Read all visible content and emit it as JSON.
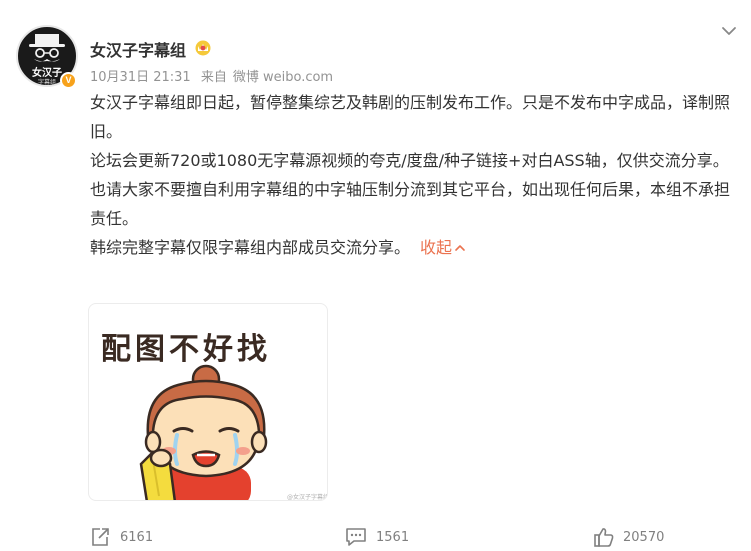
{
  "post": {
    "author": "女汉子字幕组",
    "avatar_text": "女汉子",
    "avatar_subtext": "字幕组",
    "verified_mark": "V",
    "timestamp": "10月31日 21:31",
    "source_prefix": "来自",
    "source": "微博 weibo.com",
    "paragraphs": [
      "女汉子字幕组即日起，暂停整集综艺及韩剧的压制发布工作。只是不发布中字成品，译制照旧。",
      "论坛会更新720或1080无字幕源视频的夸克/度盘/种子链接+对白ASS轴，仅供交流分享。",
      "也请大家不要擅自利用字幕组的中字轴压制分流到其它平台，如出现任何后果，本组不承担责任。",
      "韩综完整字幕仅限字幕组内部成员交流分享。"
    ],
    "collapse_label": "收起",
    "image": {
      "caption": "配图不好找",
      "watermark": "@女汉子字幕组"
    }
  },
  "actions": {
    "repost_count": "6161",
    "comment_count": "1561",
    "like_count": "20570"
  },
  "colors": {
    "accent": "#eb7350",
    "verified": "#f7a21b",
    "muted": "#939393"
  },
  "icons": [
    "chevron-down-icon",
    "crown-badge-icon",
    "repost-icon",
    "comment-icon",
    "like-icon"
  ]
}
